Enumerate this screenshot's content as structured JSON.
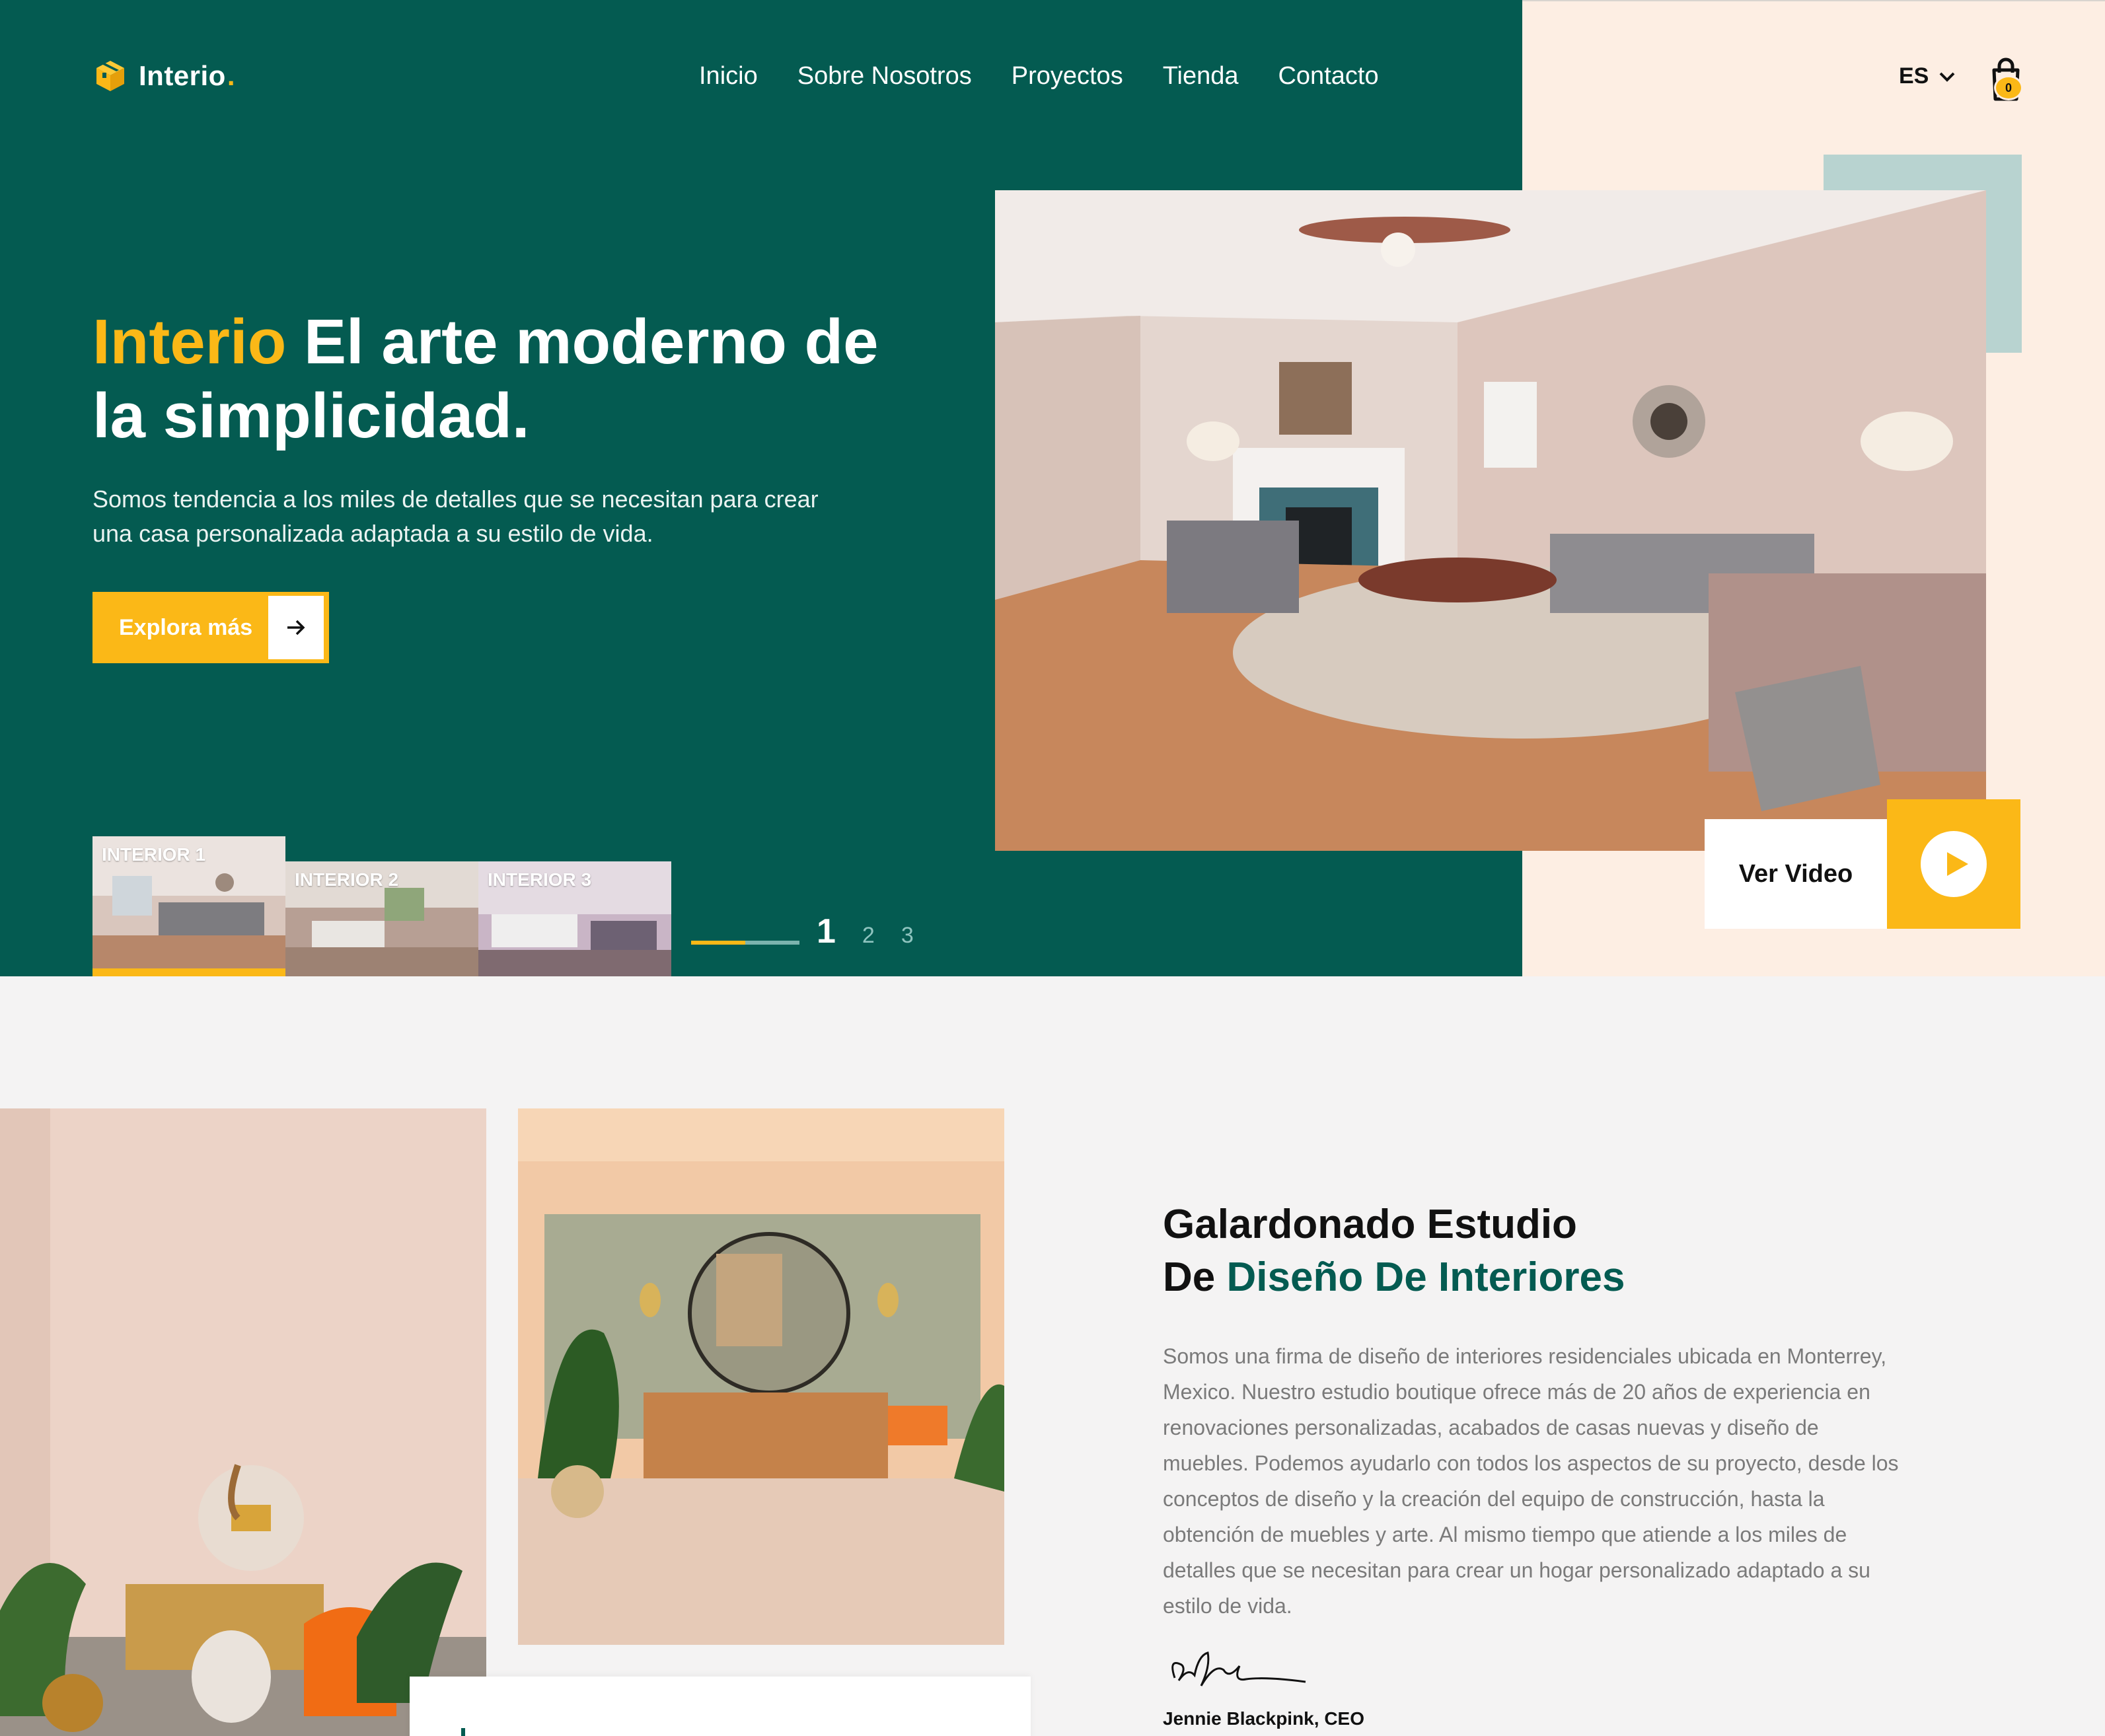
{
  "brand": {
    "name": "Interio",
    "dot": "."
  },
  "nav": {
    "items": [
      "Inicio",
      "Sobre Nosotros",
      "Proyectos",
      "Tienda",
      "Contacto"
    ]
  },
  "header": {
    "language": "ES",
    "cart_count": "0"
  },
  "hero": {
    "headline_brand": "Interio",
    "headline_rest": " El arte moderno de la simplicidad.",
    "subtext": "Somos tendencia a los miles de detalles que se necesitan para crear una casa personalizada adaptada a su estilo de vida.",
    "cta_label": "Explora más",
    "video_label": "Ver Video",
    "slider_progress": 0.5
  },
  "thumbnails": [
    {
      "label": "INTERIOR 1",
      "active": true
    },
    {
      "label": "INTERIOR 2",
      "active": false
    },
    {
      "label": "INTERIOR 3",
      "active": false
    }
  ],
  "pager": {
    "current": "1",
    "others": [
      "2",
      "3"
    ]
  },
  "about": {
    "title_line1": "Galardonado Estudio",
    "title_line2_prefix": "De ",
    "title_line2_accent": "Diseño De Interiores",
    "body": "Somos una firma de diseño de interiores residenciales ubicada en Monterrey, Mexico. Nuestro estudio boutique ofrece más de 20 años de experiencia en renovaciones personalizadas, acabados de casas nuevas y diseño de muebles. Podemos ayudarlo con todos los aspectos de su proyecto, desde los conceptos de diseño y la creación del equipo de construcción, hasta la obtención de muebles y arte. Al mismo tiempo que atiende a los miles de detalles que se necesitan para crear un hogar personalizado adaptado a su estilo de vida.",
    "author": "Jennie Blackpink, CEO"
  },
  "colors": {
    "green": "#045b51",
    "accent": "#fbb817",
    "peach": "#fdeee3",
    "teal_block": "#b8d3d0"
  },
  "icons": [
    "cube-logo-icon",
    "chevron-down-icon",
    "shopping-bag-icon",
    "arrow-right-icon",
    "play-icon"
  ]
}
